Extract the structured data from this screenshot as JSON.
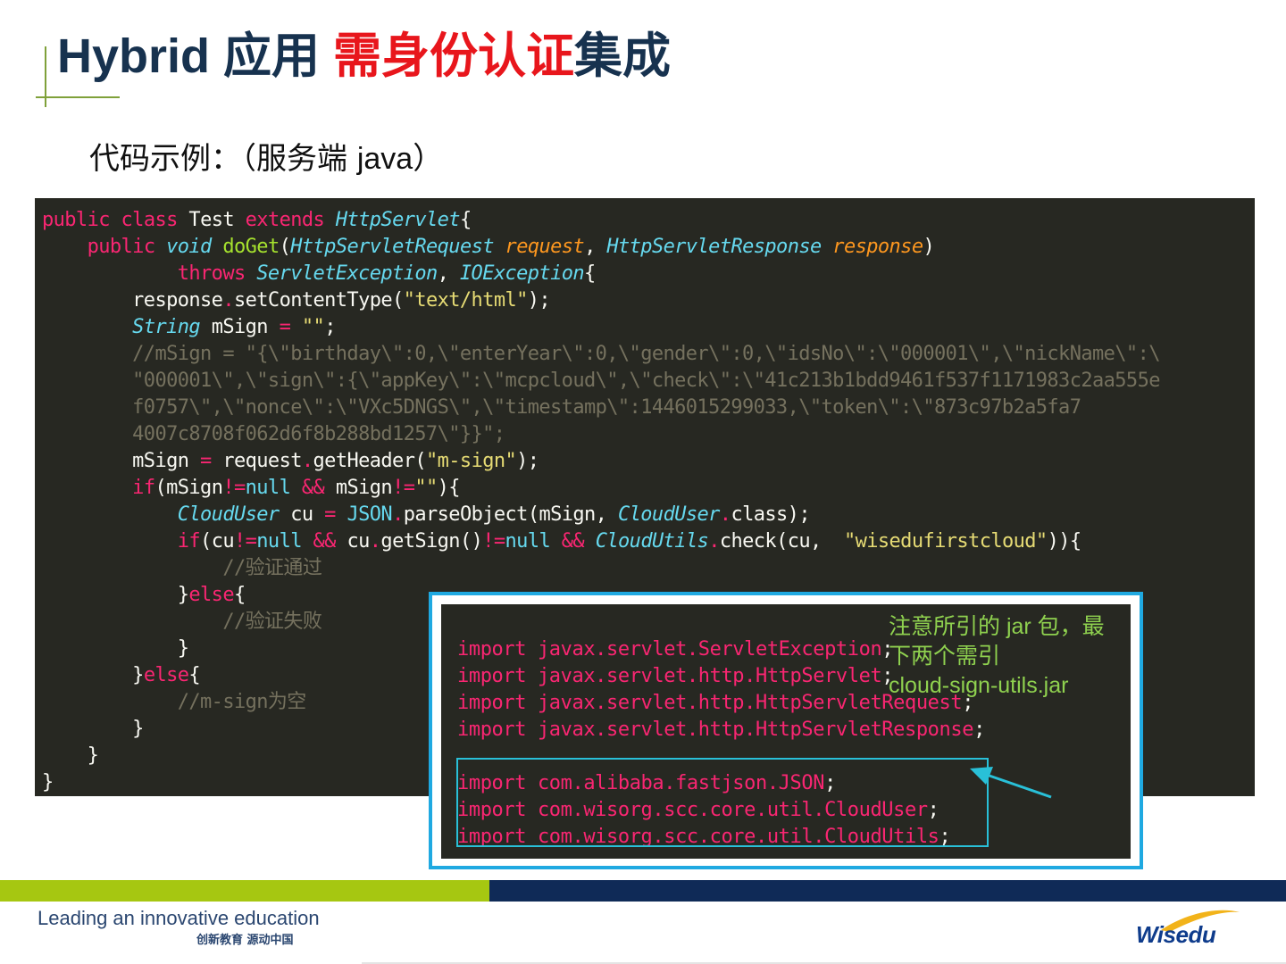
{
  "header": {
    "title_part1": "Hybrid 应用 ",
    "title_highlight": "需身份认证",
    "title_part2": "集成",
    "subtitle_prefix": "代码示例：（服务端 ",
    "subtitle_lang": "java",
    "subtitle_suffix": "）"
  },
  "code": {
    "main_lines": [
      "public class Test extends HttpServlet{",
      "    public void doGet(HttpServletRequest request, HttpServletResponse response)",
      "            throws ServletException, IOException{",
      "        response.setContentType(\"text/html\");",
      "        String mSign = \"\";",
      "        //mSign = \"{\\\"birthday\\\":0,\\\"enterYear\\\":0,\\\"gender\\\":0,\\\"idsNo\\\":\\\"000001\\\",\\\"nickName\\\":\\",
      "        \"000001\\\",\\\"sign\\\":{\\\"appKey\\\":\\\"mcpcloud\\\",\\\"check\\\":\\\"41c213b1bdd9461f537f1171983c2aa555e",
      "        f0757\\\",\\\"nonce\\\":\\\"VXc5DNGS\\\",\\\"timestamp\\\":1446015299033,\\\"token\\\":\\\"873c97b2a5fa7",
      "        4007c8708f062d6f8b288bd1257\\\"}}\";",
      "        mSign = request.getHeader(\"m-sign\");",
      "        if(mSign!=null && mSign!=\"\"){",
      "            CloudUser cu = JSON.parseObject(mSign, CloudUser.class);",
      "            if(cu!=null && cu.getSign()!=null && CloudUtils.check(cu,  \"wisedufirstcloud\")){",
      "                //验证通过",
      "            }else{",
      "                //验证失败",
      "            }",
      "        }else{",
      "            //m-sign为空",
      "        }",
      "    }",
      "}"
    ],
    "import_lines": [
      "import javax.servlet.ServletException;",
      "import javax.servlet.http.HttpServlet;",
      "import javax.servlet.http.HttpServletRequest;",
      "import javax.servlet.http.HttpServletResponse;",
      "",
      "import com.alibaba.fastjson.JSON;",
      "import com.wisorg.scc.core.util.CloudUser;",
      "import com.wisorg.scc.core.util.CloudUtils;"
    ]
  },
  "note": {
    "line1": "注意所引的 jar 包，最",
    "line2": "下两个需引",
    "line3": "cloud-sign-utils.jar"
  },
  "footer": {
    "tagline_en": "Leading an innovative education",
    "tagline_cn": "创新教育 源动中国",
    "logo_text": "Wisedu"
  },
  "colors": {
    "title": "#17324f",
    "highlight": "#e8161c",
    "code_bg": "#272822",
    "frame": "#1fa9e1",
    "note": "#8fd14f",
    "band_green": "#a6c711",
    "band_navy": "#0f2a57"
  }
}
